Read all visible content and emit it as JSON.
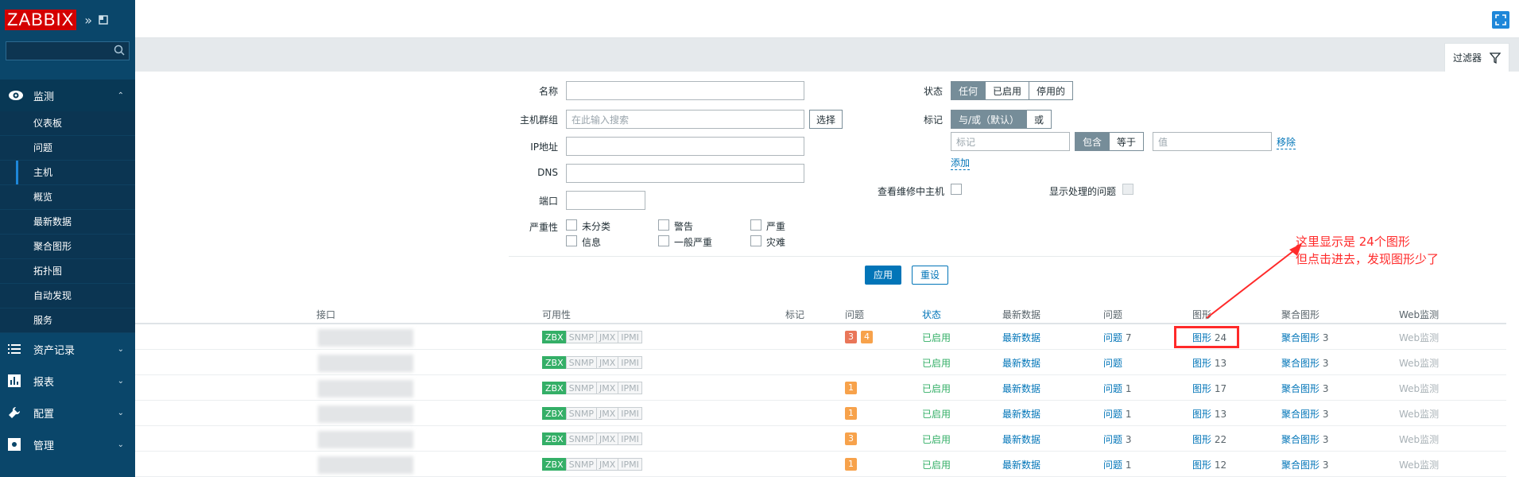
{
  "brand": {
    "logo": "ZABBIX",
    "collapse_icon": "double-chevron-icon",
    "popout_icon": "window-icon"
  },
  "search": {
    "placeholder": ""
  },
  "nav": {
    "monitoring": {
      "label": "监测",
      "items": [
        "仪表板",
        "问题",
        "主机",
        "概览",
        "最新数据",
        "聚合图形",
        "拓扑图",
        "自动发现",
        "服务"
      ],
      "selected": "主机"
    },
    "inventory": {
      "label": "资产记录"
    },
    "reports": {
      "label": "报表"
    },
    "config": {
      "label": "配置"
    },
    "admin": {
      "label": "管理"
    }
  },
  "filter": {
    "tab_label": "过滤器",
    "name_label": "名称",
    "hostgroup_label": "主机群组",
    "hostgroup_placeholder": "在此输入搜索",
    "select_btn": "选择",
    "ip_label": "IP地址",
    "dns_label": "DNS",
    "port_label": "端口",
    "severity_label": "严重性",
    "severities": [
      "未分类",
      "警告",
      "严重",
      "信息",
      "一般严重",
      "灾难"
    ],
    "status_label": "状态",
    "status_options": [
      "任何",
      "已启用",
      "停用的"
    ],
    "tags_label": "标记",
    "tags_options": [
      "与/或（默认）",
      "或"
    ],
    "tag_placeholder": "标记",
    "tag_ops": [
      "包含",
      "等于"
    ],
    "value_placeholder": "值",
    "remove_link": "移除",
    "add_link": "添加",
    "maintenance_label": "查看维修中主机",
    "suppressed_label": "显示处理的问题",
    "apply_btn": "应用",
    "reset_btn": "重设"
  },
  "table": {
    "headers": [
      "接口",
      "可用性",
      "标记",
      "问题",
      "状态",
      "最新数据",
      "问题",
      "图形",
      "聚合图形",
      "Web监测"
    ],
    "availability": [
      "ZBX",
      "SNMP",
      "JMX",
      "IPMI"
    ],
    "rows": [
      {
        "problems": [
          "3",
          "4"
        ],
        "status": "已启用",
        "latest": "最新数据",
        "problem_link": "问题",
        "problem_count": "7",
        "graphs": "图形",
        "graph_count": "24",
        "screens": "聚合图形",
        "screen_count": "3",
        "web": "Web监测"
      },
      {
        "problems": [],
        "status": "已启用",
        "latest": "最新数据",
        "problem_link": "问题",
        "problem_count": "",
        "graphs": "图形",
        "graph_count": "13",
        "screens": "聚合图形",
        "screen_count": "3",
        "web": "Web监测"
      },
      {
        "problems": [
          "1"
        ],
        "status": "已启用",
        "latest": "最新数据",
        "problem_link": "问题",
        "problem_count": "1",
        "graphs": "图形",
        "graph_count": "17",
        "screens": "聚合图形",
        "screen_count": "3",
        "web": "Web监测"
      },
      {
        "problems": [
          "1"
        ],
        "status": "已启用",
        "latest": "最新数据",
        "problem_link": "问题",
        "problem_count": "1",
        "graphs": "图形",
        "graph_count": "13",
        "screens": "聚合图形",
        "screen_count": "3",
        "web": "Web监测"
      },
      {
        "problems": [
          "3"
        ],
        "status": "已启用",
        "latest": "最新数据",
        "problem_link": "问题",
        "problem_count": "3",
        "graphs": "图形",
        "graph_count": "22",
        "screens": "聚合图形",
        "screen_count": "3",
        "web": "Web监测"
      },
      {
        "problems": [
          "1"
        ],
        "status": "已启用",
        "latest": "最新数据",
        "problem_link": "问题",
        "problem_count": "1",
        "graphs": "图形",
        "graph_count": "12",
        "screens": "聚合图形",
        "screen_count": "3",
        "web": "Web监测"
      }
    ]
  },
  "annotation": {
    "line1": "这里显示是 24个图形",
    "line2": "但点击进去，发现图形少了"
  },
  "colors": {
    "sidebar": "#0a466a",
    "accent": "#0275b8",
    "enabled": "#34af67",
    "annotation": "#ff2a2a"
  }
}
